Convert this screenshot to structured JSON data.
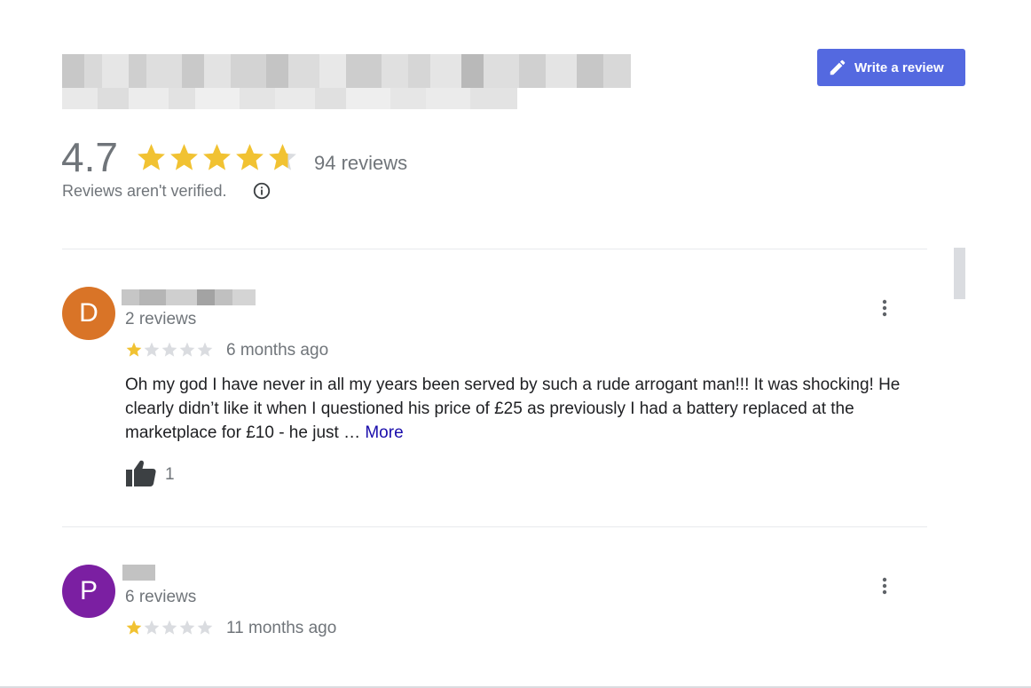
{
  "header": {
    "write_review_label": "Write a review",
    "accent_color": "#5469e0"
  },
  "summary": {
    "rating": "4.7",
    "rating_value": 4.7,
    "review_count": "94 reviews",
    "verified_note": "Reviews aren't verified."
  },
  "reviews": [
    {
      "avatar_letter": "D",
      "avatar_color": "#d97427",
      "reviewer_stats": "2 reviews",
      "stars": 1,
      "time": "6 months ago",
      "text": "Oh my god I have never in all my years been served by such a rude arrogant man!!! It was shocking! He clearly didn’t like it when I questioned his price of £25 as previously I had a battery replaced at the marketplace for £10 - he just …",
      "more_label": "More",
      "likes": "1"
    },
    {
      "avatar_letter": "P",
      "avatar_color": "#7b1fa2",
      "reviewer_stats": "6 reviews",
      "stars": 1,
      "time": "11 months ago"
    }
  ],
  "colors": {
    "star_filled": "#f1c232",
    "star_empty": "#dadce0",
    "link": "#1a0dab"
  }
}
